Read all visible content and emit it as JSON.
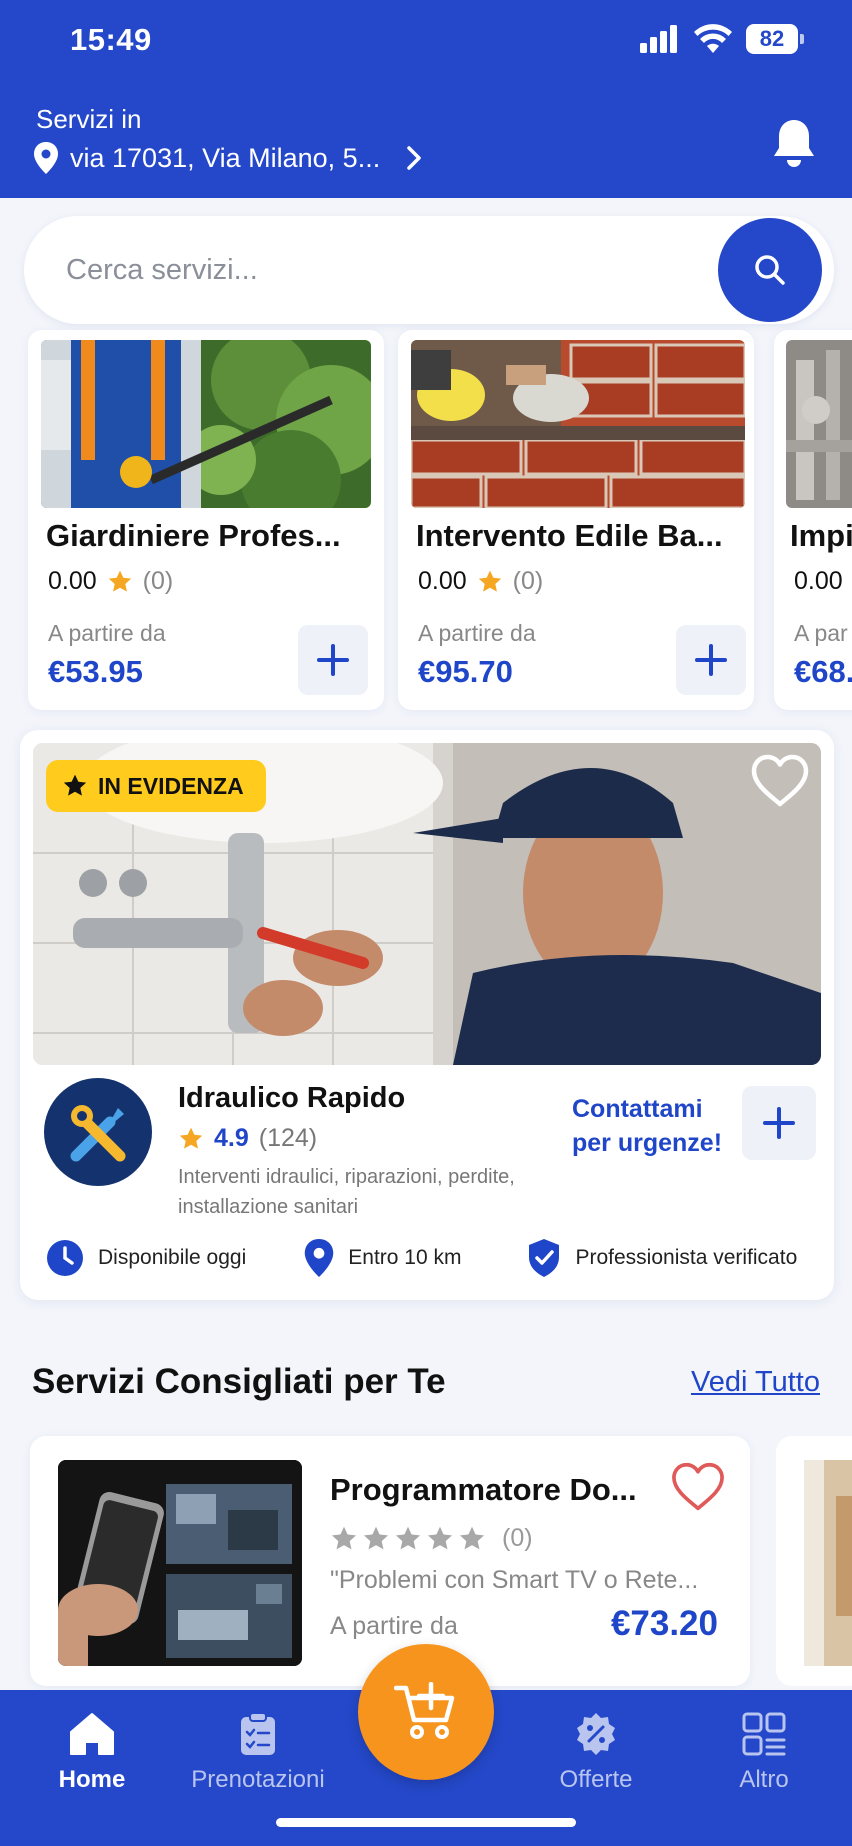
{
  "status_bar": {
    "time": "15:49",
    "battery": "82"
  },
  "header": {
    "location_label": "Servizi in",
    "location_value": "via 17031, Via Milano, 5...",
    "icons": [
      "location-pin-icon",
      "chevron-right-icon",
      "bell-icon"
    ]
  },
  "search": {
    "placeholder": "Cerca servizi..."
  },
  "service_cards": [
    {
      "title": "Giardiniere Profes...",
      "rating": "0.00",
      "count": "(0)",
      "from_label": "A partire da",
      "price": "€53.95"
    },
    {
      "title": "Intervento Edile Ba...",
      "rating": "0.00",
      "count": "(0)",
      "from_label": "A partire da",
      "price": "€95.70"
    },
    {
      "title": "Impi",
      "rating": "0.00",
      "count": "",
      "from_label": "A par",
      "price": "€68."
    }
  ],
  "featured": {
    "badge": "IN EVIDENZA",
    "title": "Idraulico Rapido",
    "rating": "4.9",
    "count": "(124)",
    "description": "Interventi idraulici, riparazioni, perdite, installazione sanitari",
    "urgent_line1": "Contattami",
    "urgent_line2": "per urgenze!",
    "features": [
      "Disponibile oggi",
      "Entro 10 km",
      "Professionista verificato"
    ]
  },
  "recommended": {
    "section_title": "Servizi Consigliati per Te",
    "see_all": "Vedi Tutto",
    "card": {
      "title": "Programmatore Do...",
      "count": "(0)",
      "description": "\"Problemi con Smart TV o Rete...",
      "from_label": "A partire da",
      "price": "€73.20"
    }
  },
  "bottom_nav": {
    "items": [
      {
        "label": "Home",
        "icon": "home-icon",
        "active": true
      },
      {
        "label": "Prenotazioni",
        "icon": "clipboard-icon",
        "active": false
      },
      {
        "label": "Offerte",
        "icon": "discount-badge-icon",
        "active": false
      },
      {
        "label": "Altro",
        "icon": "grid-icon",
        "active": false
      }
    ],
    "fab_icon": "cart-add-icon"
  },
  "colors": {
    "primary": "#2448c9",
    "accent_blue": "#1f45c8",
    "badge": "#ffcc1e",
    "fab": "#f7941d",
    "heart": "#e05a5a",
    "star": "#f5a623"
  }
}
